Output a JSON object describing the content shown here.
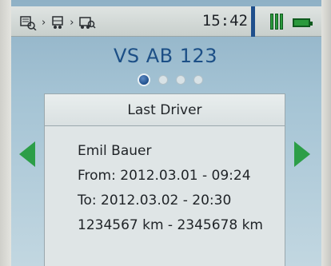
{
  "statusbar": {
    "breadcrumb": [
      "vehicle-list-icon",
      "truck-icon",
      "vehicle-detail-icon"
    ],
    "separator": "›",
    "time": "15:42",
    "signal_icon": "signal-bars-icon",
    "battery_icon": "battery-icon"
  },
  "vehicle": {
    "plate": "VS AB 123",
    "pages": 4,
    "active_page": 1
  },
  "card": {
    "title": "Last Driver",
    "driver": "Emil Bauer",
    "from": "From: 2012.03.01 - 09:24",
    "to": "To: 2012.03.02 - 20:30",
    "km": "1234567 km - 2345678 km"
  },
  "nav": {
    "prev_icon": "arrow-left-icon",
    "next_icon": "arrow-right-icon"
  },
  "colors": {
    "accent_blue": "#1f4f8c",
    "plate_text": "#1c4f86",
    "accent_green": "#2c9e48"
  }
}
